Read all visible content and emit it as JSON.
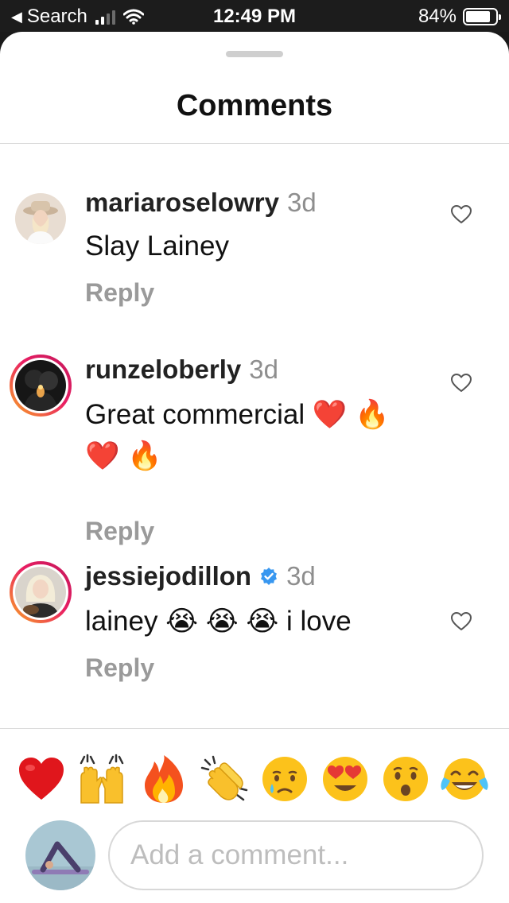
{
  "status_bar": {
    "back_label": "Search",
    "time": "12:49 PM",
    "battery": "84%",
    "battery_level": 0.84
  },
  "sheet": {
    "title": "Comments"
  },
  "comments": [
    {
      "username": "mariaroselowry",
      "time": "3d",
      "text": "Slay Lainey",
      "reply_label": "Reply",
      "verified": false,
      "story_ring": false
    },
    {
      "username": "runzeloberly",
      "time": "3d",
      "text": "Great commercial ❤️ 🔥 ❤️ 🔥",
      "reply_label": "Reply",
      "verified": false,
      "story_ring": true
    },
    {
      "username": "jessiejodillon",
      "time": "3d",
      "text": "lainey 😭 😭 😭  i love",
      "reply_label": "Reply",
      "verified": true,
      "story_ring": true
    }
  ],
  "quick_reactions": [
    "heart-icon",
    "raised-hands-icon",
    "fire-icon",
    "clapping-hands-icon",
    "crying-face-icon",
    "heart-eyes-icon",
    "surprised-face-icon",
    "tears-of-joy-icon"
  ],
  "composer": {
    "placeholder": "Add a comment..."
  },
  "colors": {
    "story_ring_start": "#f9a825",
    "story_ring_end": "#c2185b",
    "verified_blue": "#3897f0",
    "muted_text": "#8e8e8e"
  }
}
